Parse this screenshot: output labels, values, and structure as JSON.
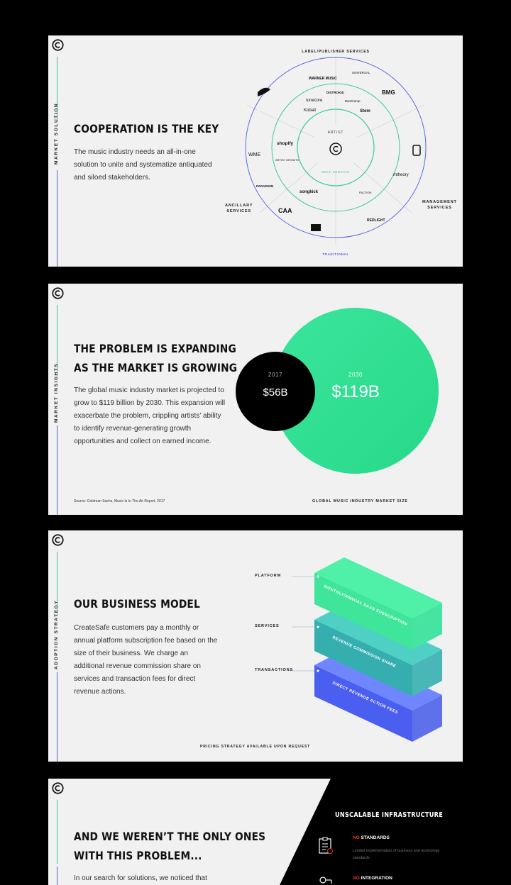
{
  "slide1": {
    "section_label": "MARKET SOLUTION",
    "title": "COOPERATION IS THE KEY",
    "body": "The music industry needs an all-in-one solution to unite and systematize antiquated and siloed stakeholders.",
    "diagram": {
      "top_label": "LABEL/PUBLISHER SERVICES",
      "left_label_line1": "ANCILLARY",
      "left_label_line2": "SERVICES",
      "right_label_line1": "MANAGEMENT",
      "right_label_line2": "SERVICES",
      "bottom_label": "TRADITIONAL",
      "center_label": "ARTIST",
      "inner_ring_label": "SELF SERVICE",
      "logos": [
        "WARNER MUSIC",
        "UNIVERSAL",
        "BMG",
        "DISTROKID",
        "tunecore",
        "Bandcamp",
        "Kobalt",
        "Stem",
        "shopify",
        "ARTIST GROWTH",
        "WME",
        "PARADIGM",
        "songkick",
        "CAA",
        "FACTION",
        "mtheory",
        "REDLIGHT"
      ]
    }
  },
  "slide2": {
    "section_label": "MARKET INSIGHTS",
    "title_line1": "THE PROBLEM IS EXPANDING",
    "title_line2": "AS THE MARKET IS GROWING",
    "body": "The global music industry market is projected to grow to $119 billion by 2030. This expansion will exacerbate the problem, crippling artists’ ability to identify revenue-generating growth opportunities and collect on earned income.",
    "source": "Source: Goldman Sachs, Music Is In The Air Report, 2017",
    "chart_caption": "GLOBAL MUSIC INDUSTRY MARKET SIZE",
    "colors": {
      "small_circle": "#000000",
      "large_circle": "#2ee08a"
    }
  },
  "slide3": {
    "section_label": "ADOPTION STRATEGY",
    "title": "OUR BUSINESS MODEL",
    "body": "CreateSafe customers pay a monthly or annual platform subscription fee based on the size of their business. We charge an additional revenue commission share on services and transaction fees for direct revenue actions.",
    "footer": "PRICING STRATEGY AVAILABLE UPON REQUEST",
    "layers": [
      {
        "label": "PLATFORM",
        "bar_text": "MONTHLY/ANNUAL SAAS SUBSCRIPTION",
        "color": "#3ee59a"
      },
      {
        "label": "SERVICES",
        "bar_text": "REVENUE COMMISSION SHARE",
        "color": "#35b3ad"
      },
      {
        "label": "TRANSACTIONS",
        "bar_text": "DIRECT REVENUE ACTION FEES",
        "color": "#4a65ef"
      }
    ]
  },
  "slide4": {
    "title_line1": "AND WE WEREN’T THE ONLY ONES",
    "title_line2": "WITH THIS PROBLEM...",
    "body": "In our search for solutions, we noticed that",
    "panel_title": "UNSCALABLE INFRASTRUCTURE",
    "items": [
      {
        "no": "NO",
        "label": " STANDARDS",
        "desc": "Limited implementation of business and technology standards"
      },
      {
        "no": "NO",
        "label": " INTEGRATION",
        "desc": ""
      }
    ],
    "accent_color": "#e0332f"
  },
  "chart_data": {
    "type": "bubble",
    "title": "GLOBAL MUSIC INDUSTRY MARKET SIZE",
    "categories": [
      "2017",
      "2030"
    ],
    "values": [
      56,
      119
    ],
    "value_labels": [
      "$56B",
      "$119B"
    ]
  }
}
